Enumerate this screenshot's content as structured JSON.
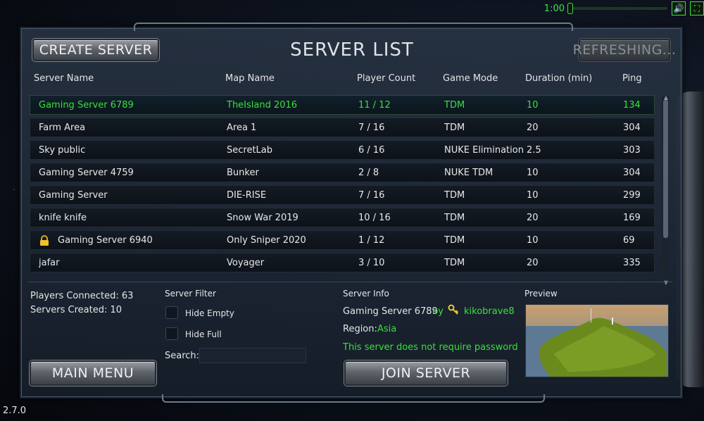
{
  "topbar": {
    "clock": "1:00"
  },
  "buttons": {
    "create_server": "CREATE SERVER",
    "refreshing": "REFRESHING...",
    "main_menu": "MAIN MENU",
    "join_server": "JOIN SERVER"
  },
  "title": "SERVER LIST",
  "columns": [
    "Server Name",
    "Map Name",
    "Player Count",
    "Game Mode",
    "Duration (min)",
    "Ping"
  ],
  "servers": [
    {
      "name": "Gaming Server 6789",
      "map": "TheIsland 2016",
      "players": "11 / 12",
      "mode": "TDM",
      "duration": "10",
      "ping": "134",
      "selected": true
    },
    {
      "name": "Farm Area",
      "map": "Area 1",
      "players": "7 / 16",
      "mode": "TDM",
      "duration": "20",
      "ping": "304"
    },
    {
      "name": "Sky public",
      "map": "SecretLab",
      "players": "6 / 16",
      "mode": "NUKE Elimination",
      "duration": "2.5",
      "ping": "303"
    },
    {
      "name": "Gaming Server 4759",
      "map": "Bunker",
      "players": "2 / 8",
      "mode": "NUKE TDM",
      "duration": "10",
      "ping": "304"
    },
    {
      "name": "Gaming Server",
      "map": "DIE-RISE",
      "players": "7 / 16",
      "mode": "TDM",
      "duration": "10",
      "ping": "299"
    },
    {
      "name": "knife knife",
      "map": "Snow War 2019",
      "players": "10 / 16",
      "mode": "TDM",
      "duration": "20",
      "ping": "169"
    },
    {
      "name": "Gaming Server 6940",
      "map": "Only Sniper 2020",
      "players": "1 / 12",
      "mode": "TDM",
      "duration": "10",
      "ping": "69",
      "locked": true
    },
    {
      "name": "jafar",
      "map": "Voyager",
      "players": "3 / 10",
      "mode": "TDM",
      "duration": "20",
      "ping": "335"
    }
  ],
  "stats": {
    "players_connected": "Players Connected: 63",
    "servers_created": "Servers Created: 10"
  },
  "filter": {
    "title": "Server Filter",
    "hide_empty": "Hide Empty",
    "hide_full": "Hide Full",
    "search_label": "Search:",
    "search_value": ""
  },
  "info": {
    "title": "Server Info",
    "server_name": "Gaming Server 6789",
    "by": "by",
    "owner": "kikobrave8",
    "region_label": "Region:",
    "region": "Asia",
    "password_note": "This server does not require password"
  },
  "preview_label": "Preview",
  "version": "2.7.0",
  "colors": {
    "accent_green": "#38e03a",
    "panel": "#1e2836"
  }
}
